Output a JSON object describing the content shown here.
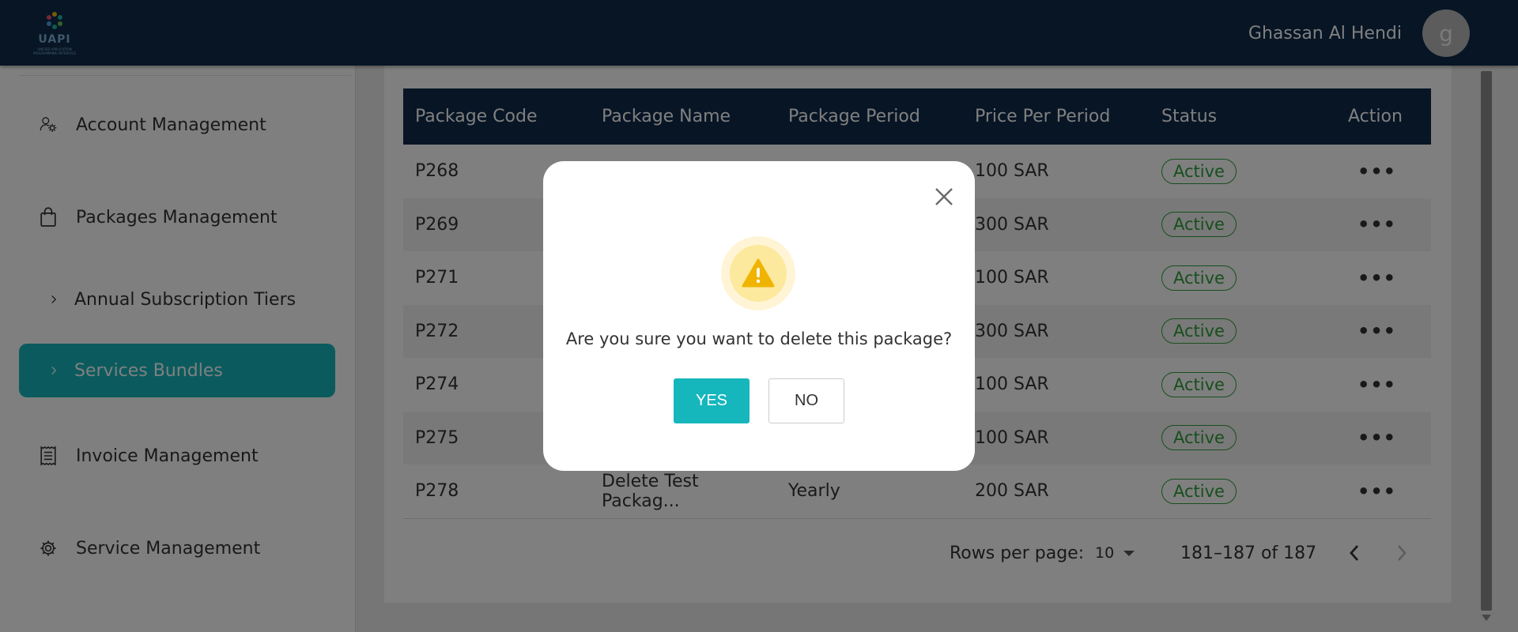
{
  "header": {
    "logo_text": "UAPI",
    "logo_subtitle": "UNIFIED APPLICATION PROGRAMMING INTERFACE",
    "user_name": "Ghassan Al Hendi",
    "avatar_letter": "g"
  },
  "sidebar": {
    "items": [
      {
        "label": "Account Management",
        "icon": "user-gear-icon"
      },
      {
        "label": "Packages Management",
        "icon": "shopping-bag-icon"
      },
      {
        "label": "Annual Subscription Tiers",
        "icon": "chevron-right-icon"
      },
      {
        "label": "Services Bundles",
        "icon": "chevron-right-icon",
        "active": true
      },
      {
        "label": "Invoice Management",
        "icon": "receipt-icon"
      },
      {
        "label": "Service Management",
        "icon": "gear-icon"
      }
    ]
  },
  "table": {
    "columns": [
      "Package Code",
      "Package Name",
      "Package Period",
      "Price Per Period",
      "Status",
      "Action"
    ],
    "rows": [
      {
        "code": "P268",
        "name": "",
        "period": "",
        "price": "100 SAR",
        "status": "Active"
      },
      {
        "code": "P269",
        "name": "",
        "period": "",
        "price": "300 SAR",
        "status": "Active"
      },
      {
        "code": "P271",
        "name": "",
        "period": "",
        "price": "100 SAR",
        "status": "Active"
      },
      {
        "code": "P272",
        "name": "",
        "period": "",
        "price": "300 SAR",
        "status": "Active"
      },
      {
        "code": "P274",
        "name": "",
        "period": "",
        "price": "100 SAR",
        "status": "Active"
      },
      {
        "code": "P275",
        "name": "",
        "period": "",
        "price": "100 SAR",
        "status": "Active"
      },
      {
        "code": "P278",
        "name": "Delete Test Packag...",
        "period": "Yearly",
        "price": "200 SAR",
        "status": "Active"
      }
    ],
    "action_glyph": "•••"
  },
  "pagination": {
    "rows_per_page_label": "Rows per page:",
    "rows_per_page_value": "10",
    "range_text": "181–187 of 187"
  },
  "modal": {
    "message": "Are you sure you want to delete this package?",
    "yes_label": "YES",
    "no_label": "NO"
  },
  "colors": {
    "header_bg": "#0e2a4b",
    "accent": "#16b6bd",
    "status_green": "#2e9e3a",
    "warning": "#f0b400"
  }
}
